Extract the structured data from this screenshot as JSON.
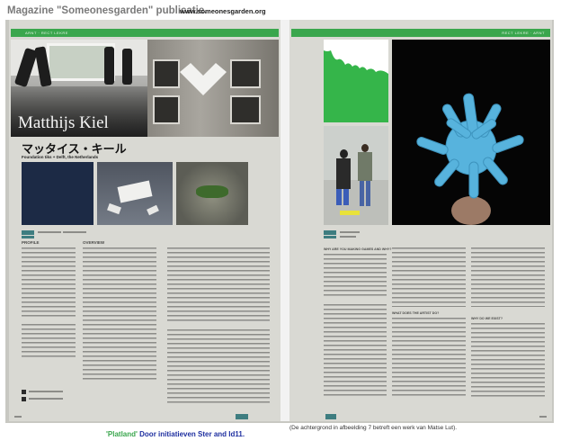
{
  "magazine": {
    "title": "Magazine \"Someonesgarden\" publicatie.",
    "url": "www.someonesgarden.org"
  },
  "left_page": {
    "header_text": "ARNT · RECT LEKRE",
    "artist_name": "Matthijs Kiel",
    "artist_name_jp": "マッタイス・キール",
    "subtitle": "Foundation tiks + Delft, the Netherlands",
    "col1_title": "PROFILE",
    "col2_title": "OVERVIEW"
  },
  "right_page": {
    "header_text": "RECT LEKRE · ARNT",
    "col1_title": "WHY ARE YOU MAKING GAMES AND WHY?",
    "col2_title": "WHAT DOES THE ARTIST DO?",
    "col3_title": "WHY DO WE EXIST?"
  },
  "footer": {
    "caption": "(De achtergrond in afbeelding 7 betreft een werk van Matse Lut).",
    "note_plat": "'Platland'",
    "note_rest": " Door initiatieven Ster and Id11."
  },
  "colors": {
    "accent": "#3aa64d",
    "page": "#d9d9d3",
    "teal": "#3e7d80",
    "sculpture": "#57b3dd"
  }
}
